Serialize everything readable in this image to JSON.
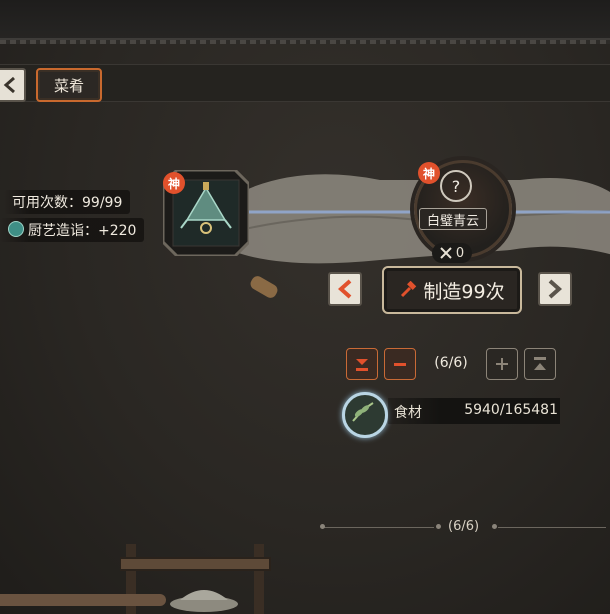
{
  "tabs": {
    "back_icon": "chevron-left-icon",
    "active_label": "菜肴"
  },
  "recipe": {
    "uses_label": "可用次数：99/99",
    "skill_label": "厨艺造诣：+220",
    "rank_badge": "神"
  },
  "target": {
    "rank_badge": "神",
    "unknown_mark": "?",
    "name": "白璧青云",
    "owned_count": "0"
  },
  "craft": {
    "button_label": "制造99次"
  },
  "quantity": {
    "value": "(6/6)"
  },
  "ingredient": {
    "label": "食材",
    "amount": "5940/165481"
  },
  "pager": {
    "label": "(6/6)"
  },
  "colors": {
    "accent_orange": "#e1512c",
    "button_border": "#c9b99c"
  }
}
